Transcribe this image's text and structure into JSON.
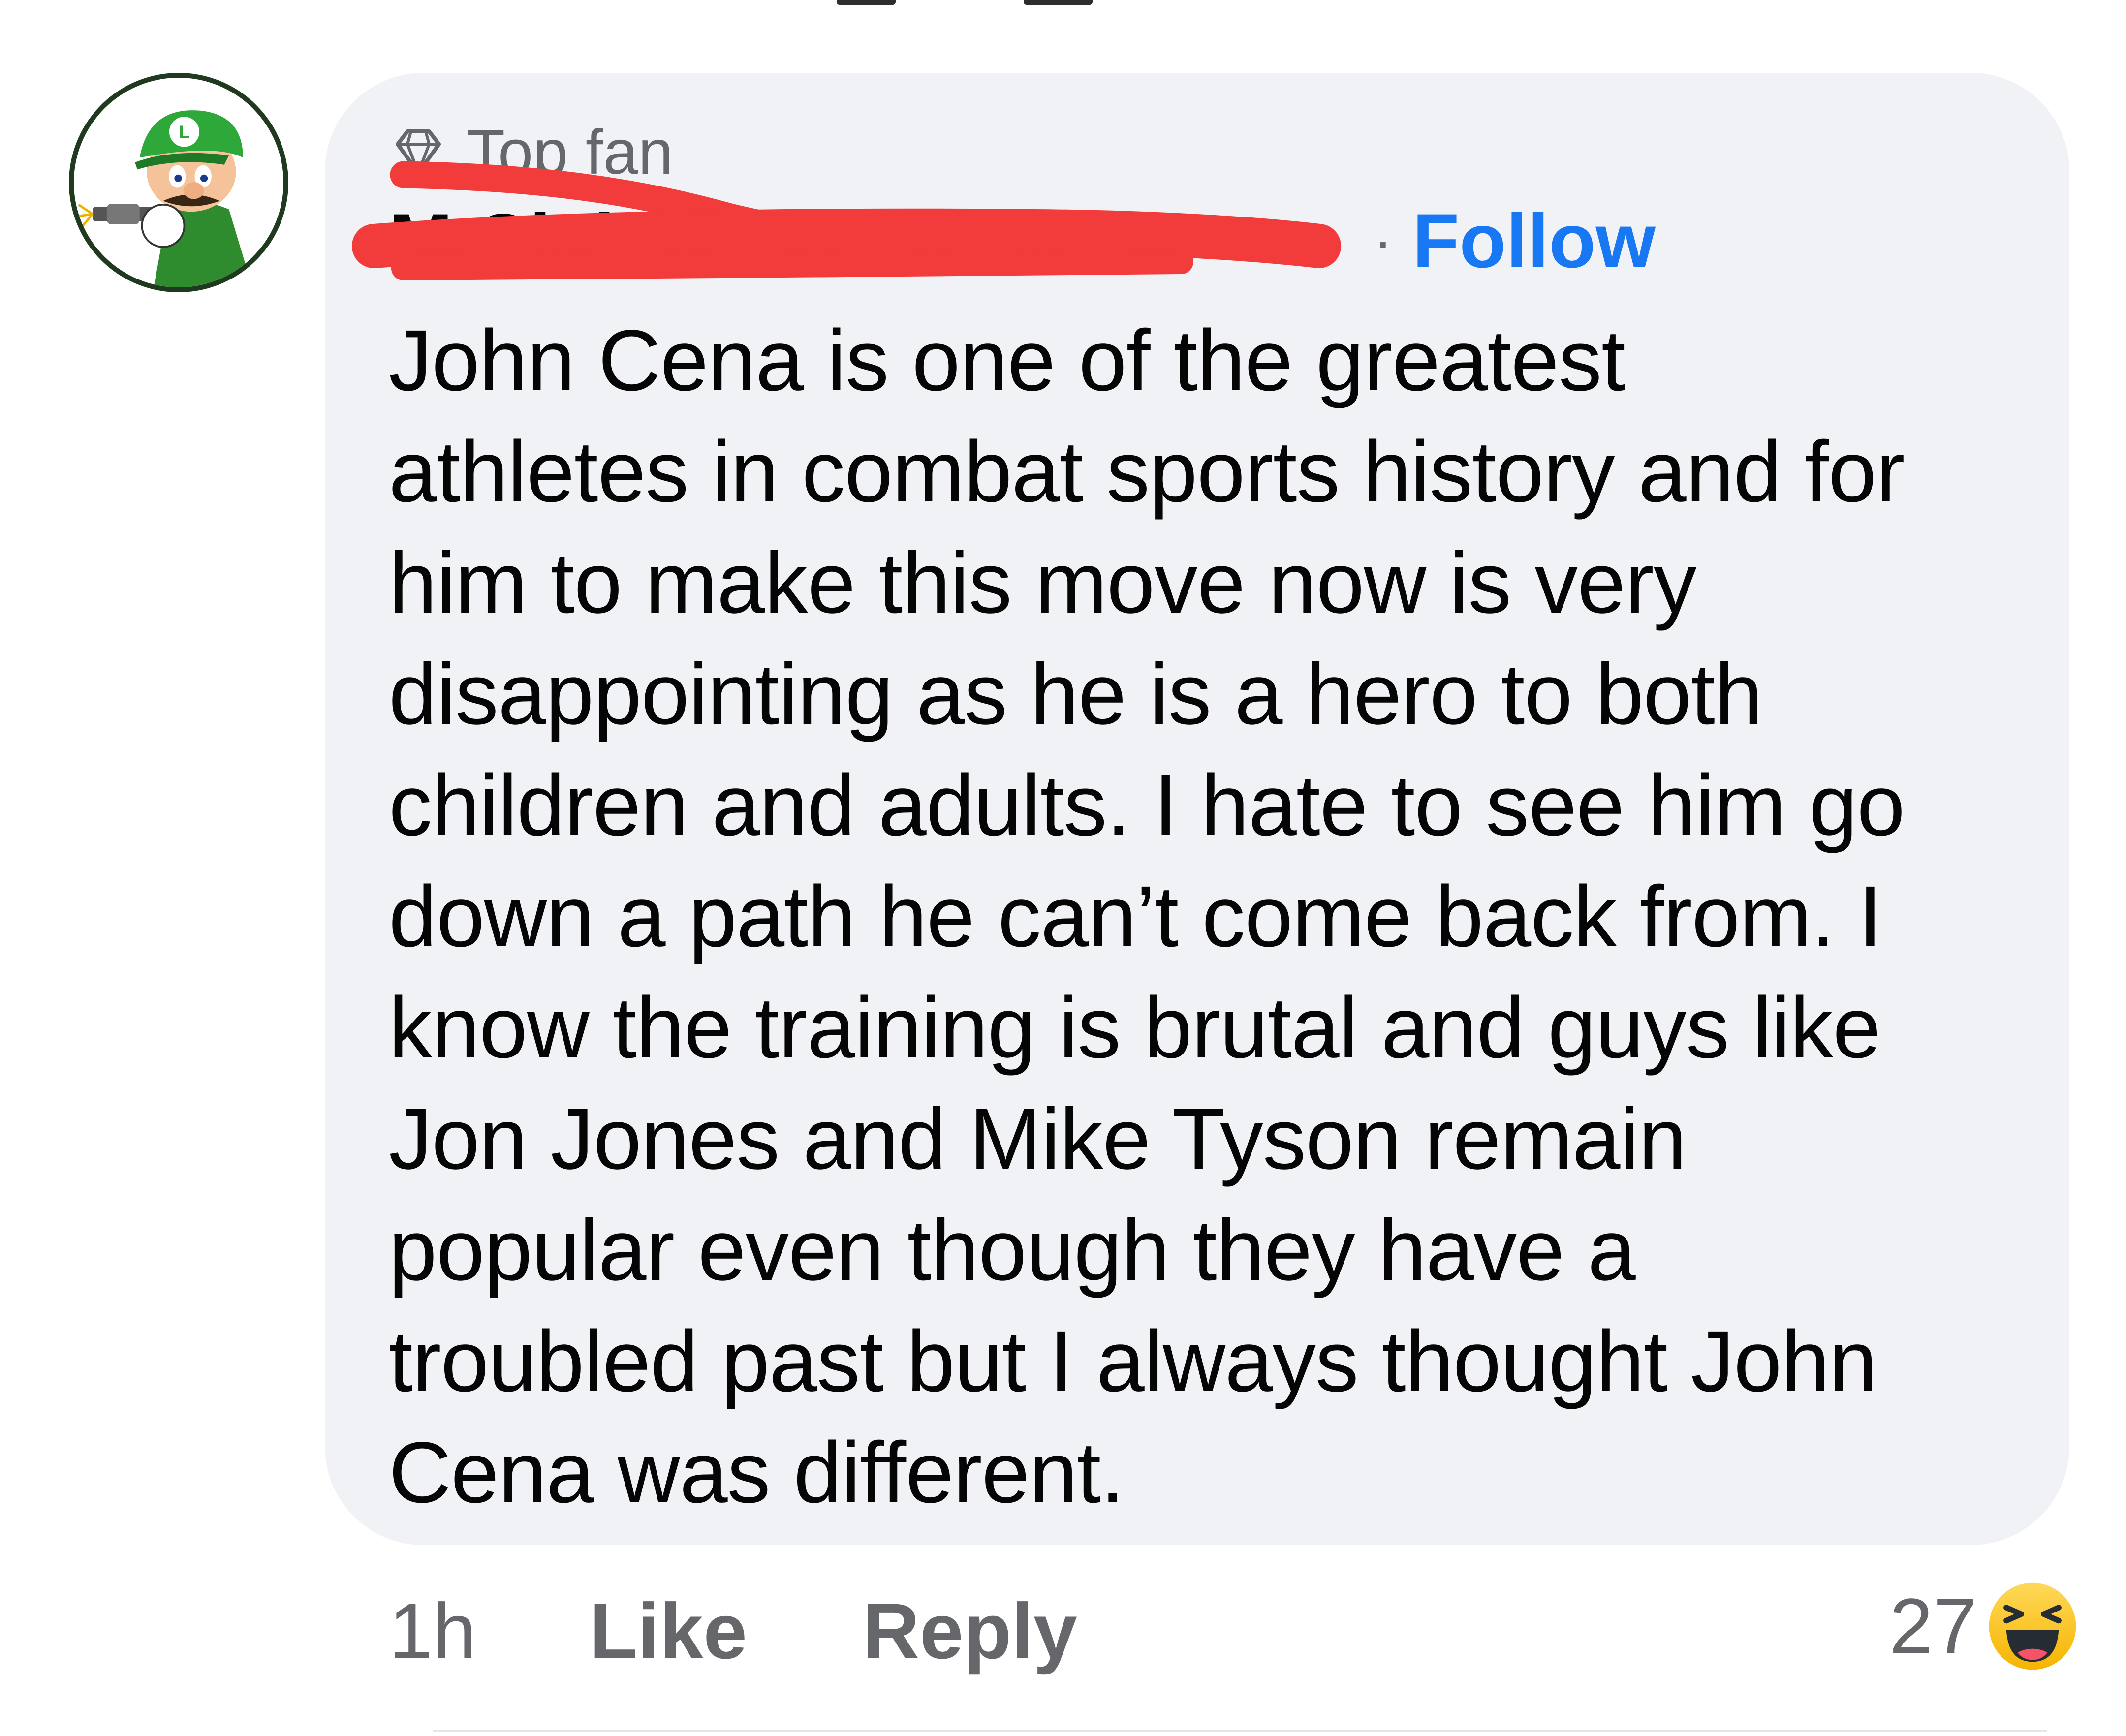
{
  "comment": {
    "author": {
      "badge_icon": "diamond-icon",
      "badge_label": "Top fan",
      "name": "M                                     Clake",
      "name_redacted": true,
      "separator": "·",
      "follow_label": "Follow"
    },
    "body": "John Cena is one of the greatest\nathletes in combat sports history and for\nhim to make this move now is very\ndisappointing as he is a hero to both\nchildren and adults. I hate to see him go\ndown a path he can’t come back from. I\nknow the training is brutal and guys like\nJon Jones and Mike Tyson remain\npopular even though they have a\ntroubled past but I always thought John\nCena was different.",
    "actions": {
      "timestamp": "1h",
      "like_label": "Like",
      "reply_label": "Reply"
    },
    "reactions": {
      "count": "27",
      "icon": "haha-emoji-icon"
    }
  },
  "colors": {
    "bubble_bg": "#f0f2f5",
    "text_primary": "#050505",
    "text_secondary": "#65676b",
    "link_blue": "#1877f2",
    "redaction_red": "#f23b3b"
  }
}
